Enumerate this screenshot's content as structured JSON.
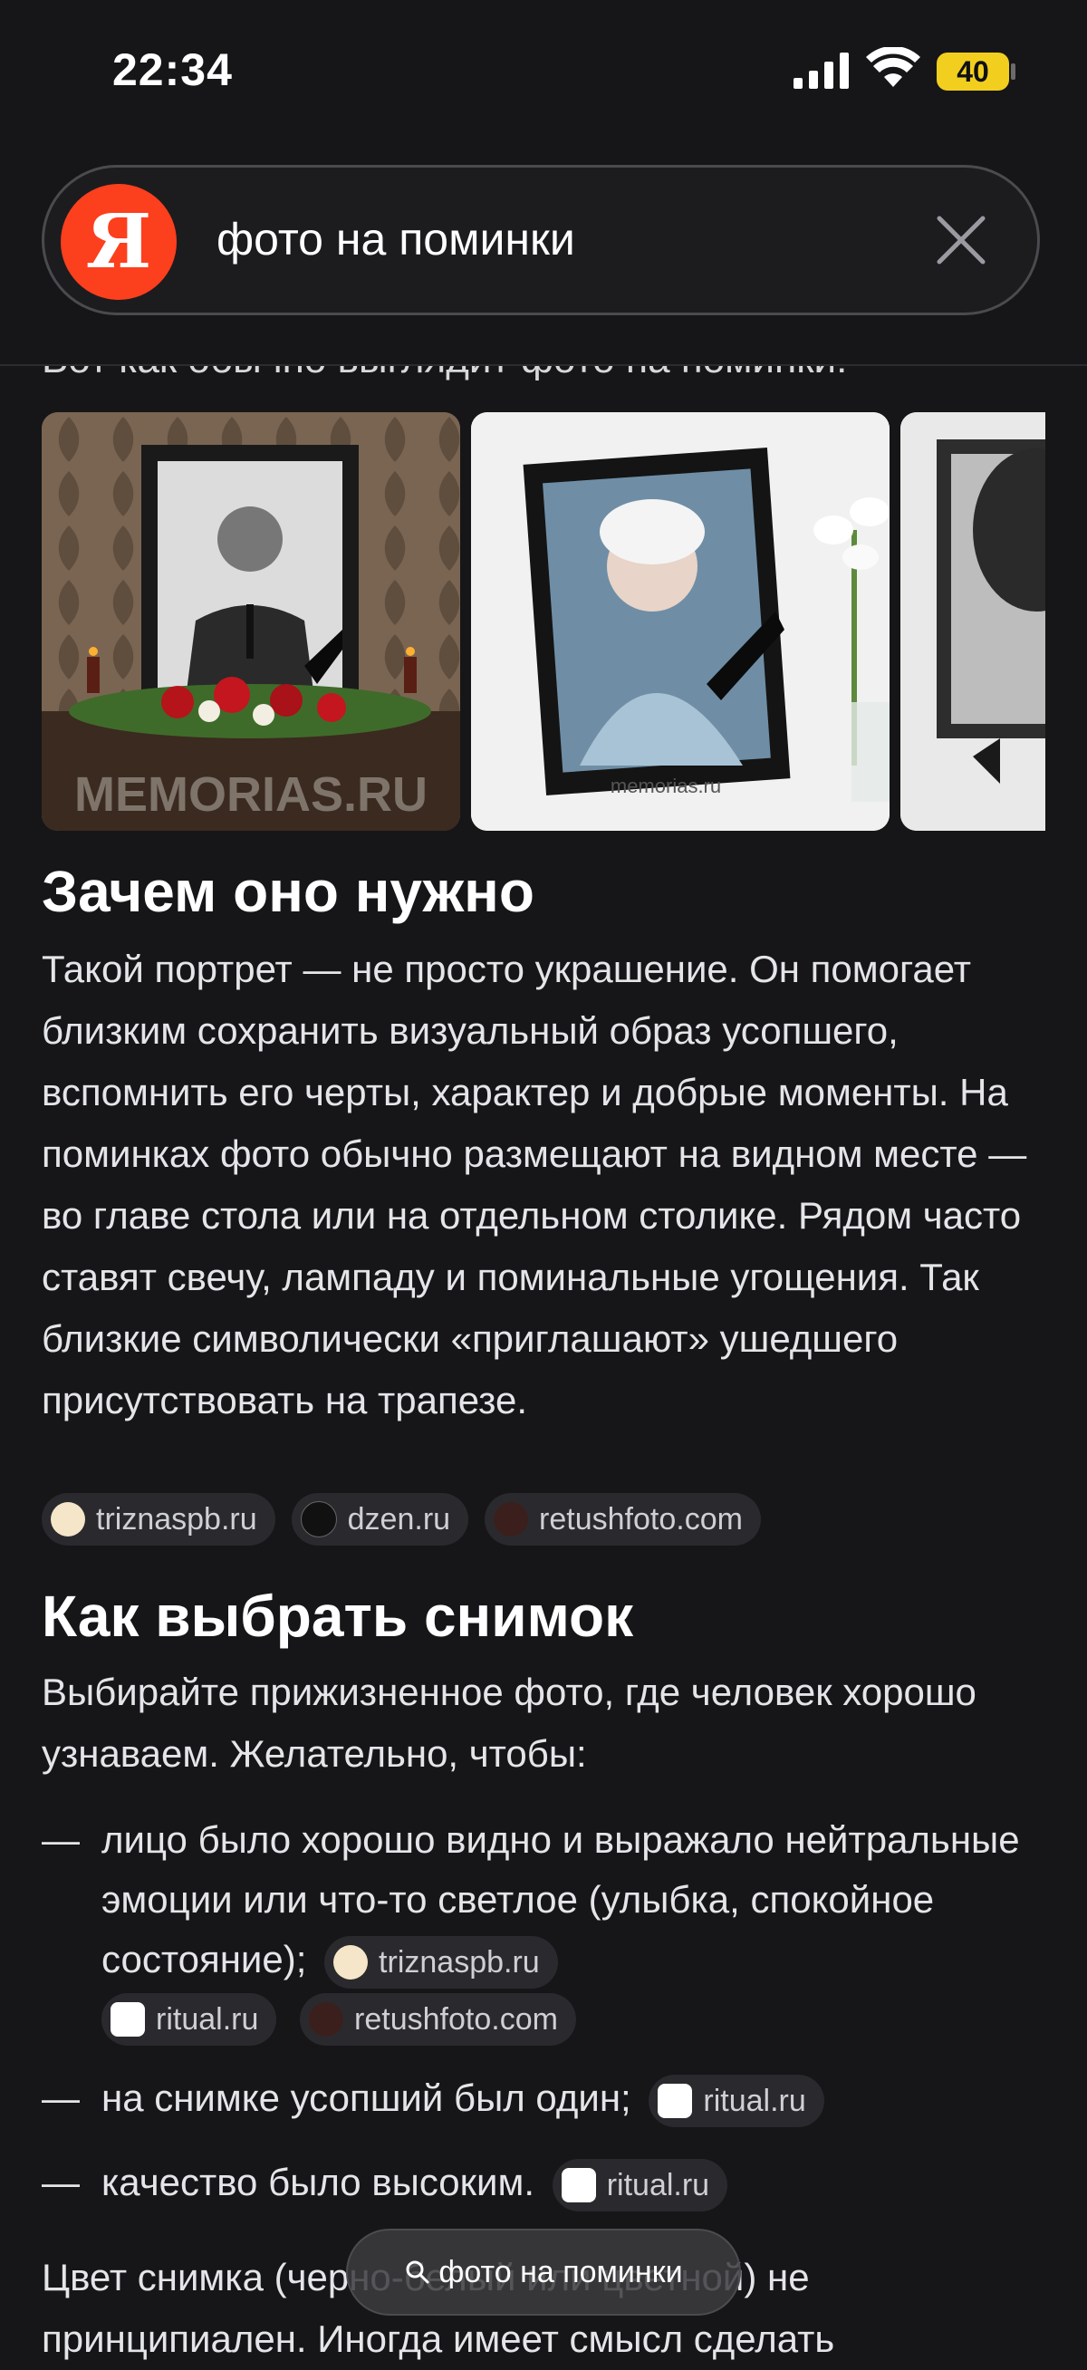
{
  "status_bar": {
    "time": "22:34",
    "battery": "40"
  },
  "search": {
    "query": "фото на поминки"
  },
  "content": {
    "cut_line": "Вот как обычно выглядит фото на поминки:",
    "gallery": [
      {
        "watermark": "MEMORIAS.RU"
      },
      {
        "watermark": "memorias.ru"
      },
      {
        "watermark": ""
      }
    ],
    "section1": {
      "title": "Зачем оно нужно",
      "text": "Такой портрет — не просто украшение. Он помогает близким сохранить визуальный образ усопшего, вспомнить его черты, характер и добрые моменты. На поминках фото обычно размещают на видном месте — во главе стола или на отдельном столике. Рядом часто ставят свечу, лампаду и поминальные угощения. Так близкие символически «приглашают» ушедшего присутствовать на трапезе.",
      "sources": [
        "triznaspb.ru",
        "dzen.ru",
        "retushfoto.com"
      ]
    },
    "section2": {
      "title": "Как выбрать снимок",
      "intro": "Выбирайте прижизненное фото, где человек хорошо узнаваем. Желательно, чтобы:",
      "bullets": [
        {
          "dash": "—",
          "text": "лицо было хорошо видно и выражало нейтральные эмоции или что-то светлое (улыбка, спокойное состояние);",
          "sources": [
            "triznaspb.ru",
            "ritual.ru",
            "retushfoto.com"
          ]
        },
        {
          "dash": "—",
          "text": "на снимке усопший был один;",
          "sources": [
            "ritual.ru"
          ]
        },
        {
          "dash": "—",
          "text": "качество было высоким.",
          "sources": [
            "ritual.ru"
          ]
        }
      ],
      "tail": "Цвет снимка (черно-белый или цветной) не принципиален. Иногда имеет смысл сделать"
    }
  },
  "float_search": {
    "label": "фото на поминки"
  }
}
